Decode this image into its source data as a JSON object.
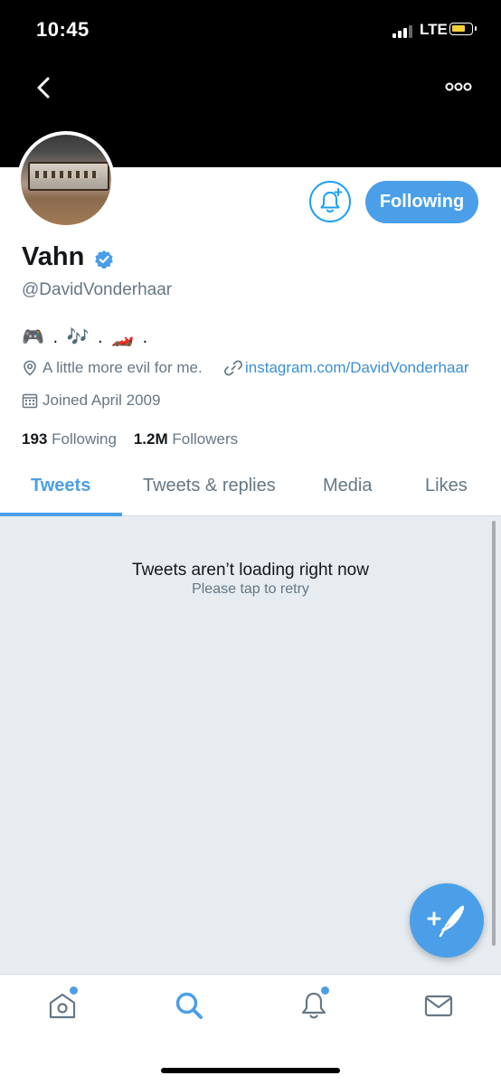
{
  "status_bar": {
    "time": "10:45",
    "network": "LTE"
  },
  "header": {
    "back_icon": "chevron-left-icon",
    "more_icon": "more-dots-icon"
  },
  "profile": {
    "name": "Vahn",
    "handle": "@DavidVonderhaar",
    "bio": "🎮 . 🎶 . 🏎️ .",
    "location": "A little more evil for me.",
    "website": "instagram.com/DavidVonderhaar",
    "joined": "Joined April 2009",
    "following_count": "193",
    "following_label": "Following",
    "followers_count": "1.2M",
    "followers_label": "Followers"
  },
  "actions": {
    "follow_button": "Following",
    "notify_icon": "bell-plus-icon"
  },
  "tabs": [
    {
      "label": "Tweets",
      "active": true
    },
    {
      "label": "Tweets & replies",
      "active": false
    },
    {
      "label": "Media",
      "active": false
    },
    {
      "label": "Likes",
      "active": false
    }
  ],
  "feed": {
    "error_title": "Tweets aren’t loading right now",
    "error_subtitle": "Please tap to retry"
  },
  "compose_icon": "compose-feather-icon",
  "bottom_nav": [
    {
      "icon": "home-icon",
      "badge": true
    },
    {
      "icon": "search-icon",
      "badge": false,
      "active": true
    },
    {
      "icon": "notifications-icon",
      "badge": true
    },
    {
      "icon": "messages-icon",
      "badge": false
    }
  ],
  "colors": {
    "accent": "#4a9fe8",
    "secondary_text": "#657786",
    "feed_bg": "#e6ecf0"
  }
}
